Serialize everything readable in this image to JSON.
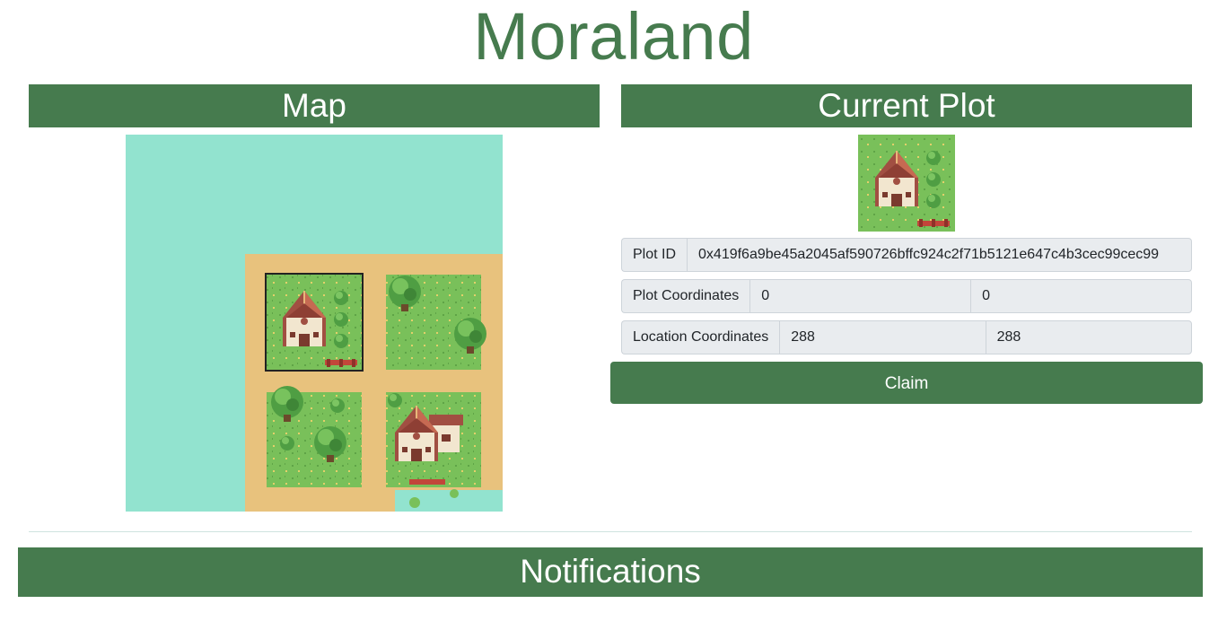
{
  "app": {
    "title": "Moraland"
  },
  "map": {
    "header": "Map",
    "colors": {
      "water": "#92e3cf",
      "sand": "#e8c27d",
      "grass": "#79c05a",
      "roof": "#a14f42",
      "tree": "#4f9e43"
    },
    "selected_plot_outline": "#222222"
  },
  "current_plot": {
    "header": "Current Plot",
    "plot_id_label": "Plot ID",
    "plot_id_value": "0x419f6a9be45a2045af590726bffc924c2f71b5121e647c4b3cec99cec99",
    "plot_coordinates_label": "Plot Coordinates",
    "plot_x": "0",
    "plot_y": "0",
    "location_coordinates_label": "Location Coordinates",
    "location_x": "288",
    "location_y": "288",
    "claim_label": "Claim"
  },
  "notifications": {
    "header": "Notifications"
  },
  "theme": {
    "primary": "#467b4e"
  }
}
